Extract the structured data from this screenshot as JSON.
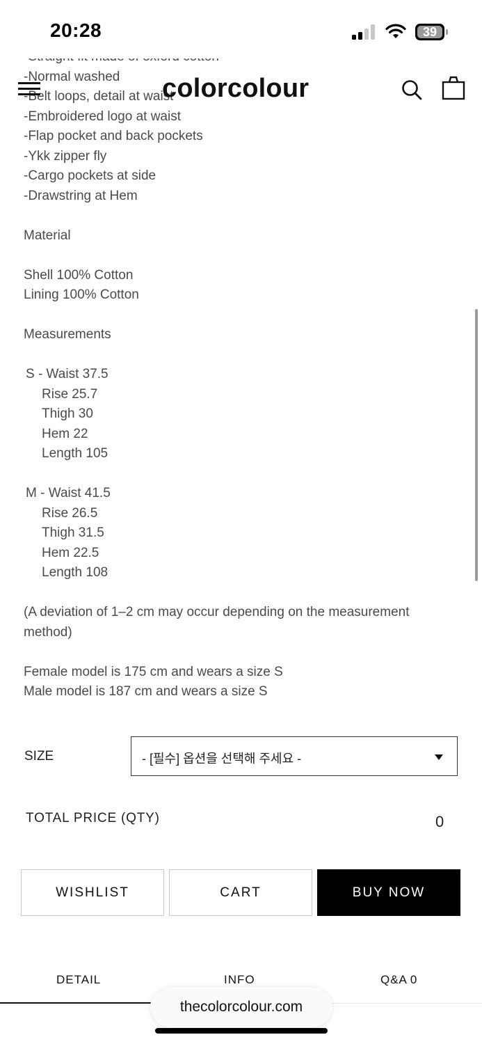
{
  "status_bar": {
    "time": "20:28",
    "battery_level": "39",
    "icons": [
      "cellular-signal-icon",
      "wifi-icon",
      "battery-icon"
    ]
  },
  "header": {
    "logo": "colorcolour",
    "icons": [
      "hamburger-menu-icon",
      "search-icon",
      "shopping-bag-icon"
    ]
  },
  "description": {
    "features": [
      "-Straight fit made of oxford cotton",
      "-Normal washed",
      "-Belt loops,  detail at waist",
      "-Embroidered logo at waist",
      "-Flap pocket and back pockets",
      "-Ykk zipper fly",
      "-Cargo pockets at side",
      "-Drawstring at Hem"
    ],
    "material_title": "Material",
    "material": [
      "Shell 100%  Cotton",
      "Lining 100% Cotton"
    ],
    "measurements_title": "Measurements",
    "sizes": [
      {
        "first": "S - Waist   37.5",
        "rows": [
          "Rise    25.7",
          "Thigh   30",
          "Hem    22",
          "Length  105"
        ]
      },
      {
        "first": "M - Waist  41.5",
        "rows": [
          "Rise    26.5",
          "Thigh  31.5",
          "Hem    22.5",
          "Length  108"
        ]
      }
    ],
    "deviation_note": "(A deviation of 1–2 cm may occur depending on the measurement method)",
    "model_info": [
      "Female model is 175 cm and wears a size S",
      "Male model is 187 cm and wears a size S"
    ]
  },
  "options": {
    "size_label": "SIZE",
    "size_select_value": "- [필수] 옵션을 선택해 주세요 -",
    "total_label": "TOTAL PRICE (QTY)",
    "total_value": "0"
  },
  "actions": {
    "wishlist": "WISHLIST",
    "cart": "CART",
    "buy_now": "BUY NOW"
  },
  "tabs": {
    "detail": "DETAIL",
    "info": "INFO",
    "qa": "Q&A",
    "qa_count": "0"
  },
  "browser": {
    "url": "thecolorcolour.com"
  },
  "colors": {
    "accent": "#000000",
    "body_text": "#4a4a4a",
    "button_border": "#c9c9c9"
  }
}
